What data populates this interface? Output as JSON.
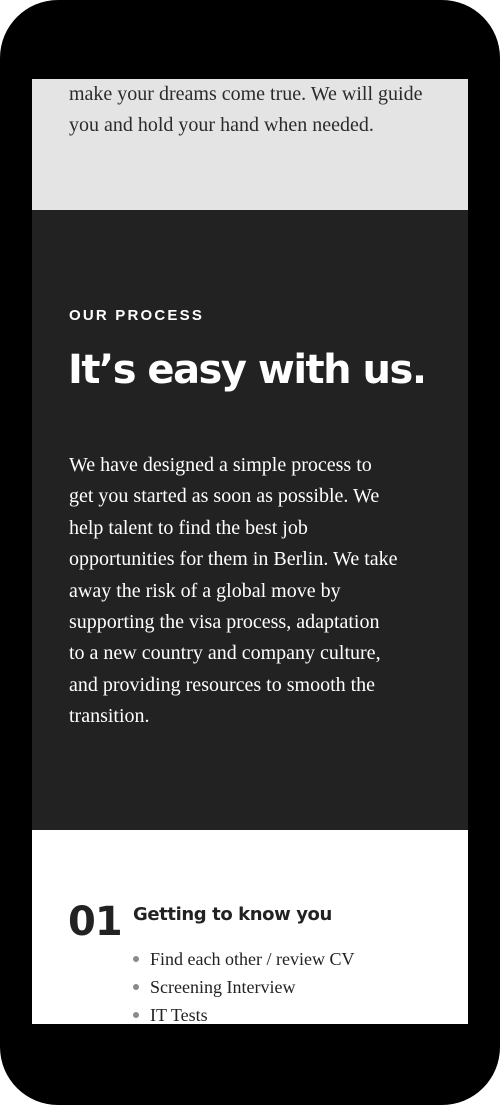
{
  "intro": {
    "text": "make your dreams come true. We will guide you and hold your hand when needed."
  },
  "process": {
    "eyebrow": "OUR PROCESS",
    "heading": "It’s easy with us.",
    "body": "We have designed a simple process to get you started as soon as possible. We help talent to find the best job opportunities for them in Berlin. We take away the risk of a global move by supporting the visa process, adaptation to a new country and company culture, and providing resources to smooth the transition."
  },
  "steps": [
    {
      "number": "01",
      "title": "Getting to know you",
      "items": [
        "Find each other / review CV",
        "Screening Interview",
        "IT Tests"
      ]
    }
  ],
  "colors": {
    "frame": "#000000",
    "intro_bg": "#e4e4e4",
    "dark_bg": "#222222",
    "text_dark": "#222222",
    "text_light": "#ffffff",
    "bullet": "#8a8a8a"
  }
}
